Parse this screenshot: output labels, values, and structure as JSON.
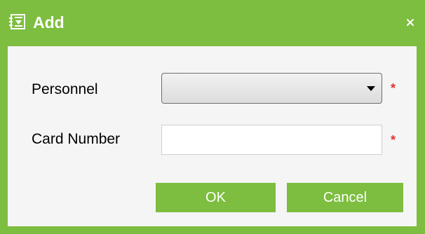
{
  "dialog": {
    "title": "Add",
    "title_icon": "add-record-icon",
    "close_icon": "close-icon",
    "accent_color": "#7dbd3f"
  },
  "form": {
    "personnel": {
      "label": "Personnel",
      "value": "",
      "required_mark": "*"
    },
    "card_number": {
      "label": "Card Number",
      "value": "",
      "required_mark": "*"
    }
  },
  "buttons": {
    "ok_label": "OK",
    "cancel_label": "Cancel"
  }
}
